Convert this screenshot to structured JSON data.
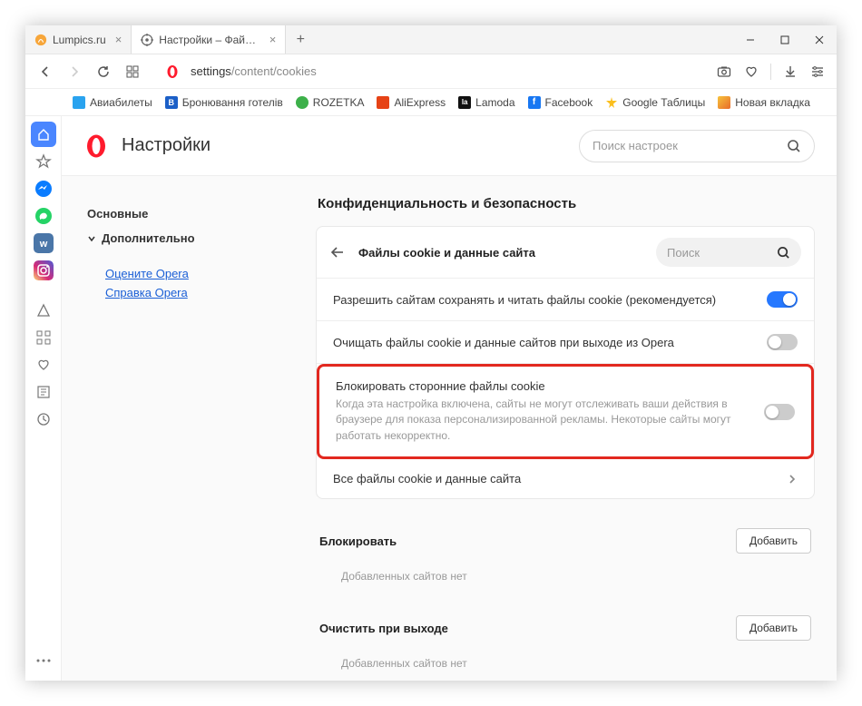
{
  "tabs": [
    {
      "label": "Lumpics.ru",
      "active": false
    },
    {
      "label": "Настройки – Файлы cookie",
      "active": true
    }
  ],
  "url": {
    "prefix": "settings",
    "path": "/content/cookies"
  },
  "bookmarks": [
    {
      "label": "Авиабилеты",
      "color": "#2aa3ef"
    },
    {
      "label": "Бронювання готелів",
      "color": "#1b5fc7"
    },
    {
      "label": "ROZETKA",
      "color": "#3db04a"
    },
    {
      "label": "AliExpress",
      "color": "#e64316"
    },
    {
      "label": "Lamoda",
      "color": "#111"
    },
    {
      "label": "Facebook",
      "color": "#1877f2"
    },
    {
      "label": "Google Таблицы",
      "color": "#fbbf1e"
    },
    {
      "label": "Новая вкладка",
      "color": "#f7c33c"
    }
  ],
  "settings": {
    "title": "Настройки",
    "search_placeholder": "Поиск настроек",
    "nav": {
      "basic": "Основные",
      "advanced": "Дополнительно",
      "rate": "Оцените Opera",
      "help": "Справка Opera"
    },
    "section": "Конфиденциальность и безопасность",
    "card_title": "Файлы cookie и данные сайта",
    "card_search": "Поиск",
    "rows": {
      "allow": "Разрешить сайтам сохранять и читать файлы cookie (рекомендуется)",
      "clear": "Очищать файлы cookie и данные сайтов при выходе из Opera",
      "block_title": "Блокировать сторонние файлы cookie",
      "block_desc": "Когда эта настройка включена, сайты не могут отслеживать ваши действия в браузере для показа персонализированной рекламы. Некоторые сайты могут работать некорректно.",
      "all": "Все файлы cookie и данные сайта"
    },
    "block_section": {
      "title": "Блокировать",
      "add": "Добавить",
      "empty": "Добавленных сайтов нет"
    },
    "clear_section": {
      "title": "Очистить при выходе",
      "add": "Добавить",
      "empty": "Добавленных сайтов нет"
    }
  }
}
